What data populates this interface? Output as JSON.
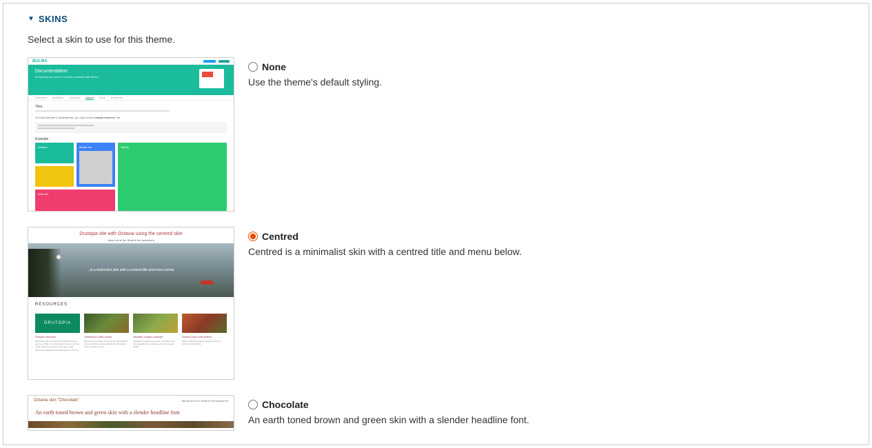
{
  "section": {
    "title": "SKINS",
    "description": "Select a skin to use for this theme."
  },
  "skins": [
    {
      "id": "none",
      "label": "None",
      "description": "Use the theme's default styling.",
      "selected": false,
      "preview": {
        "brand": "BULMA",
        "hero_title": "Documentation",
        "section_title": "Tiles",
        "example_label": "Example",
        "tile_labels": {
          "vertical": "Vertical...",
          "middle": "Middle tile",
          "tall": "Tall tile",
          "wide": "Wide tile"
        }
      }
    },
    {
      "id": "centred",
      "label": "Centred",
      "description": "Centred is a minimalist skin with a centred title and menu below.",
      "selected": true,
      "preview": {
        "site_title": "Drutopia site with Octavia using the centred skin",
        "nav": "About Us ▾   Our Work ▾   Get Involved ▾",
        "hero_caption": "...is a minimalist skin with a centred title and menu below.",
        "resources_heading": "RESOURCES",
        "card_brand": "DRUTOPIA",
        "card_titles": [
          "Sample resource",
          "Vestibulum ante ipsum",
          "Aliquam congue suscipit",
          "Aenean quis velit finibus"
        ]
      }
    },
    {
      "id": "chocolate",
      "label": "Chocolate",
      "description": "An earth toned brown and green skin with a slender headline font.",
      "selected": false,
      "preview": {
        "site_title": "Octavia skin \"Chocolate\"",
        "nav": "About Us ▾   Our Work ▾   Get Involved ▾",
        "headline": "An earth toned brown and green skin with a slender headline font"
      }
    }
  ]
}
